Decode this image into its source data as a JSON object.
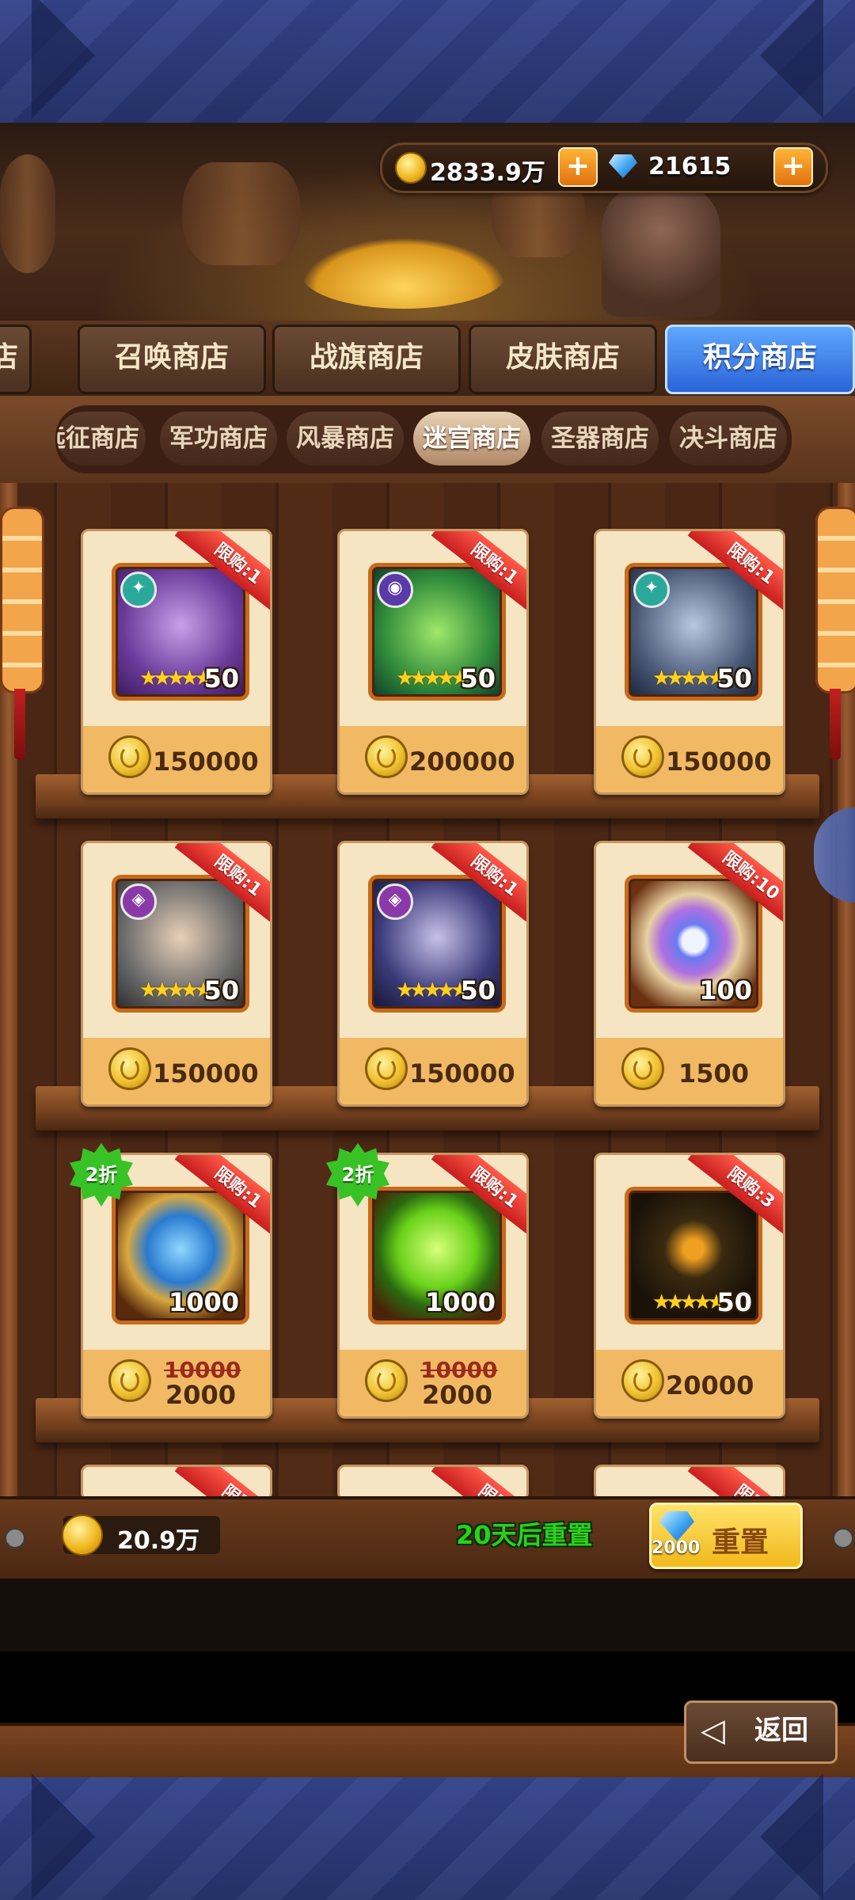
{
  "currency": {
    "gold": "2833.9万",
    "gems": "21615",
    "plus": "+"
  },
  "main_tabs": [
    {
      "label": "店"
    },
    {
      "label": "召唤商店"
    },
    {
      "label": "战旗商店"
    },
    {
      "label": "皮肤商店"
    },
    {
      "label": "积分商店",
      "active": true
    }
  ],
  "sub_tabs": [
    {
      "label": "远征商店"
    },
    {
      "label": "军功商店"
    },
    {
      "label": "风暴商店"
    },
    {
      "label": "迷宫商店",
      "active": true
    },
    {
      "label": "圣器商店"
    },
    {
      "label": "决斗商店"
    }
  ],
  "items": [
    {
      "limit": "限购:1",
      "level": "50",
      "stars": "★★★★★",
      "price": "150000"
    },
    {
      "limit": "限购:1",
      "level": "50",
      "stars": "★★★★★",
      "price": "200000"
    },
    {
      "limit": "限购:1",
      "level": "50",
      "stars": "★★★★★",
      "price": "150000"
    },
    {
      "limit": "限购:1",
      "level": "50",
      "stars": "★★★★★",
      "price": "150000"
    },
    {
      "limit": "限购:1",
      "level": "50",
      "stars": "★★★★★",
      "price": "150000"
    },
    {
      "limit": "限购:10",
      "level": "100",
      "price": "1500"
    },
    {
      "limit": "限购:1",
      "level": "1000",
      "discount": "2折",
      "old_price": "10000",
      "new_price": "2000"
    },
    {
      "limit": "限购:1",
      "level": "1000",
      "discount": "2折",
      "old_price": "10000",
      "new_price": "2000"
    },
    {
      "limit": "限购:3",
      "level": "50",
      "stars": "★★★★★",
      "price": "20000"
    },
    {
      "limit": "限购"
    },
    {
      "limit": "限购"
    },
    {
      "limit": "限购"
    }
  ],
  "footer": {
    "points": "20.9万",
    "reset_timer": "20天后重置",
    "reset_cost": "2000",
    "reset_label": "重置"
  },
  "back_label": "返回",
  "colors": {
    "active_tab": "#2a63d6",
    "limit_ribbon": "#c81e1e",
    "discount_badge": "#38c225",
    "reset_timer_text": "#2ad21a"
  },
  "icons": [
    "gold-coin-icon",
    "gem-icon",
    "plus-icon",
    "points-coin-icon",
    "back-arrow-icon"
  ]
}
